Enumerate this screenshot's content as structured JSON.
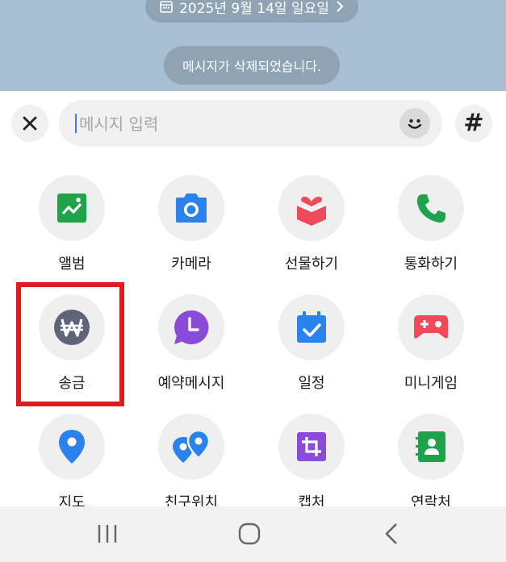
{
  "chat": {
    "date_label": "2025년 9월 14일 일요일",
    "deleted_notice": "메시지가 삭제되었습니다."
  },
  "input": {
    "placeholder": "메시지 입력"
  },
  "menu": {
    "items": [
      {
        "label": "앨범",
        "icon": "album-icon"
      },
      {
        "label": "카메라",
        "icon": "camera-icon"
      },
      {
        "label": "선물하기",
        "icon": "gift-icon"
      },
      {
        "label": "통화하기",
        "icon": "phone-icon"
      },
      {
        "label": "송금",
        "icon": "won-icon"
      },
      {
        "label": "예약메시지",
        "icon": "clock-icon"
      },
      {
        "label": "일정",
        "icon": "calendar-icon"
      },
      {
        "label": "미니게임",
        "icon": "gamepad-icon"
      },
      {
        "label": "지도",
        "icon": "map-pin-icon"
      },
      {
        "label": "친구위치",
        "icon": "friends-location-icon"
      },
      {
        "label": "캡처",
        "icon": "crop-icon"
      },
      {
        "label": "연락처",
        "icon": "contacts-icon"
      }
    ]
  },
  "colors": {
    "chat_background": "#a9bfd2",
    "highlight_border": "#e01b1b"
  }
}
